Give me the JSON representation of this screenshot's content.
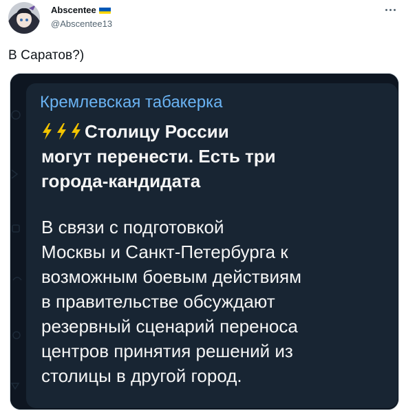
{
  "author": {
    "display_name": "Abscentee",
    "handle": "@Abscentee13",
    "flag_icon": "ukraine-flag-icon",
    "flag_colors": [
      "#0057b7",
      "#ffd700"
    ]
  },
  "menu": {
    "icon": "more-horizontal-icon"
  },
  "tweet": {
    "text": "В Саратов?)"
  },
  "media": {
    "channel_name": "Кремлевская табакерка",
    "headline_icons": [
      "lightning-icon",
      "lightning-icon",
      "lightning-icon"
    ],
    "headline_lines": [
      "Столицу России",
      "могут перенести. Есть три",
      "города-кандидата"
    ],
    "body_lines": [
      "В связи с подготовкой",
      "Москвы и Санкт-Петербурга к",
      "возможным боевым действиям",
      "в правительстве обсуждают",
      "резервный сценарий переноса",
      "центров принятия решений из",
      "столицы в другой город."
    ],
    "colors": {
      "background": "#0e1621",
      "bubble": "#182533",
      "channel_name": "#6ab3f3",
      "text": "#f5f5f5",
      "lightning": "#f2c300"
    }
  }
}
